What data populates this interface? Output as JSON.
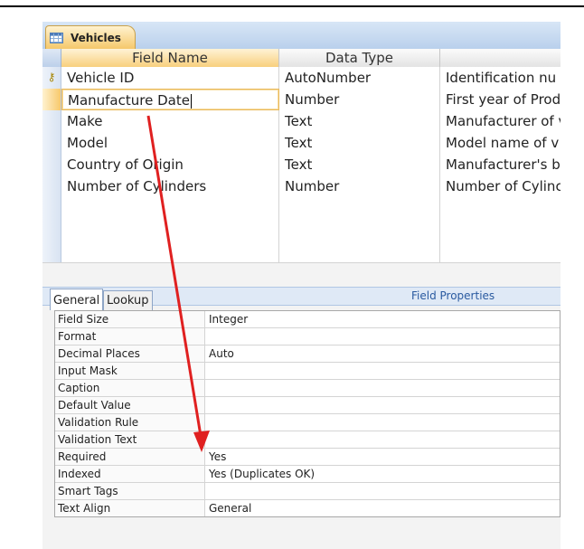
{
  "tab": {
    "label": "Vehicles"
  },
  "design_grid": {
    "headers": [
      "Field Name",
      "Data Type",
      ""
    ],
    "rows": [
      {
        "field": "Vehicle ID",
        "type": "AutoNumber",
        "desc": "Identification nu",
        "key": true
      },
      {
        "field": "Manufacture Date",
        "type": "Number",
        "desc": "First year of Prod",
        "current": true
      },
      {
        "field": "Make",
        "type": "Text",
        "desc": "Manufacturer of v"
      },
      {
        "field": "Model",
        "type": "Text",
        "desc": "Model name of v"
      },
      {
        "field": "Country of Origin",
        "type": "Text",
        "desc": "Manufacturer's b"
      },
      {
        "field": "Number of Cylinders",
        "type": "Number",
        "desc": "Number of Cylinc"
      },
      {
        "field": "",
        "type": "",
        "desc": ""
      },
      {
        "field": "",
        "type": "",
        "desc": ""
      },
      {
        "field": "",
        "type": "",
        "desc": ""
      }
    ]
  },
  "field_properties": {
    "title": "Field Properties",
    "tabs": [
      "General",
      "Lookup"
    ],
    "rows": [
      {
        "name": "Field Size",
        "value": "Integer"
      },
      {
        "name": "Format",
        "value": ""
      },
      {
        "name": "Decimal Places",
        "value": "Auto"
      },
      {
        "name": "Input Mask",
        "value": ""
      },
      {
        "name": "Caption",
        "value": ""
      },
      {
        "name": "Default Value",
        "value": ""
      },
      {
        "name": "Validation Rule",
        "value": ""
      },
      {
        "name": "Validation Text",
        "value": ""
      },
      {
        "name": "Required",
        "value": "Yes"
      },
      {
        "name": "Indexed",
        "value": "Yes (Duplicates OK)"
      },
      {
        "name": "Smart Tags",
        "value": ""
      },
      {
        "name": "Text Align",
        "value": "General"
      }
    ]
  },
  "colors": {
    "annotation_arrow": "#e02020",
    "tab_active": "#f5c86b",
    "header_band": "#dfe9f6"
  },
  "icons": {
    "tab_icon": "table-icon",
    "key_icon": "primary-key-icon"
  }
}
